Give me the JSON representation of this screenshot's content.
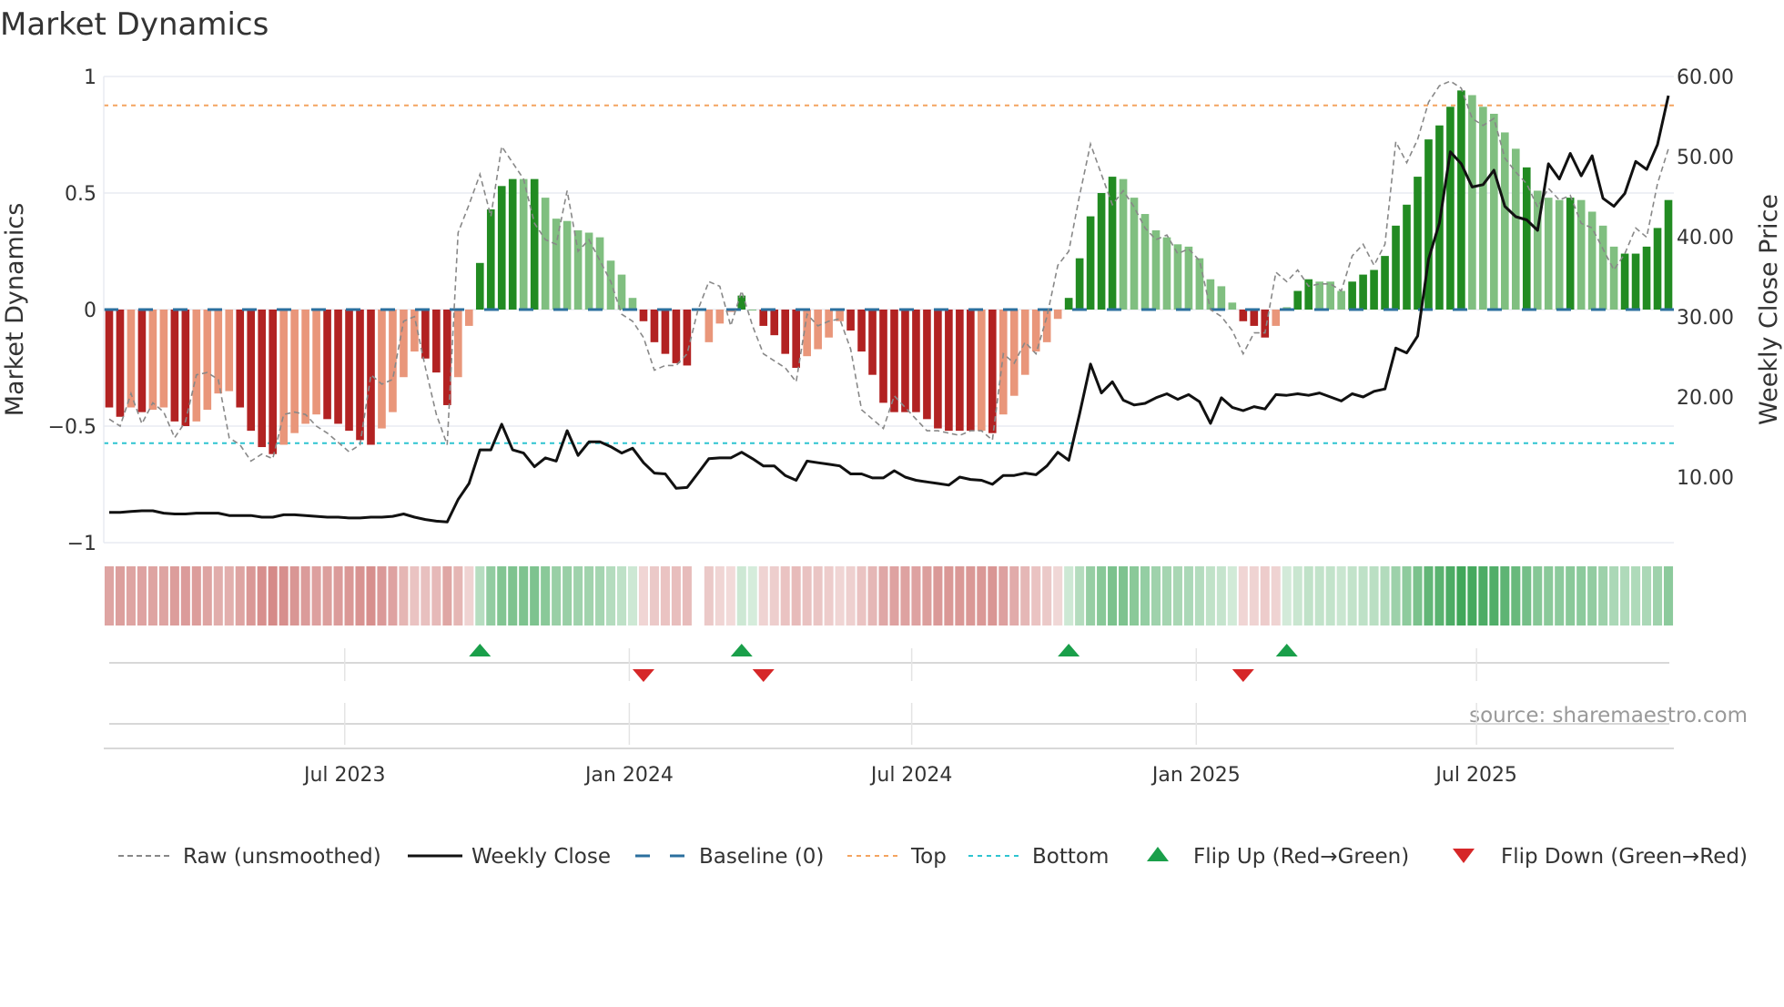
{
  "chart_data": {
    "type": "bar",
    "title": "Market Dynamics",
    "ylabel": "Market Dynamics",
    "y2label": "Weekly Close Price",
    "ylim": [
      -1,
      1
    ],
    "y2lim": [
      0,
      60
    ],
    "yticks": [
      "1",
      "0.5",
      "0",
      "−0.5",
      "−1"
    ],
    "ytick_values": [
      1,
      0.5,
      0,
      -0.5,
      -1
    ],
    "y2ticks": [
      "60.00",
      "50.00",
      "40.00",
      "30.00",
      "20.00",
      "10.00"
    ],
    "y2tick_values": [
      60,
      50,
      40,
      30,
      20,
      10
    ],
    "x_ticks": [
      {
        "label": "Jul 2023",
        "week": 22.6
      },
      {
        "label": "Jan 2024",
        "week": 48.7
      },
      {
        "label": "Jul 2024",
        "week": 74.6
      },
      {
        "label": "Jan 2025",
        "week": 100.7
      },
      {
        "label": "Jul 2025",
        "week": 126.4
      }
    ],
    "top_level": 0.876,
    "bottom_level": -0.573,
    "baseline": 0,
    "smoothed": [
      -0.42,
      -0.46,
      -0.42,
      -0.44,
      -0.43,
      -0.42,
      -0.48,
      -0.5,
      -0.48,
      -0.43,
      -0.36,
      -0.35,
      -0.42,
      -0.52,
      -0.59,
      -0.62,
      -0.58,
      -0.53,
      -0.49,
      -0.45,
      -0.47,
      -0.49,
      -0.52,
      -0.56,
      -0.58,
      -0.51,
      -0.44,
      -0.29,
      -0.18,
      -0.21,
      -0.27,
      -0.41,
      -0.29,
      -0.07,
      0.2,
      0.43,
      0.53,
      0.56,
      0.56,
      0.56,
      0.48,
      0.39,
      0.38,
      0.34,
      0.33,
      0.31,
      0.21,
      0.15,
      0.05,
      -0.05,
      -0.14,
      -0.19,
      -0.23,
      -0.24,
      null,
      -0.14,
      -0.06,
      -0.01,
      0.06,
      0,
      -0.07,
      -0.11,
      -0.19,
      -0.25,
      -0.2,
      -0.17,
      -0.12,
      -0.05,
      -0.09,
      -0.18,
      -0.28,
      -0.4,
      -0.44,
      -0.44,
      -0.44,
      -0.47,
      -0.51,
      -0.52,
      -0.52,
      -0.52,
      -0.52,
      -0.53,
      -0.45,
      -0.37,
      -0.28,
      -0.18,
      -0.14,
      -0.04,
      0.05,
      0.22,
      0.4,
      0.5,
      0.57,
      0.56,
      0.48,
      0.41,
      0.34,
      0.31,
      0.28,
      0.27,
      0.22,
      0.13,
      0.1,
      0.03,
      -0.05,
      -0.07,
      -0.12,
      -0.07,
      0.01,
      0.08,
      0.13,
      0.12,
      0.12,
      0.08,
      0.12,
      0.15,
      0.17,
      0.23,
      0.36,
      0.45,
      0.57,
      0.73,
      0.79,
      0.87,
      0.94,
      0.92,
      0.87,
      0.84,
      0.76,
      0.69,
      0.61,
      0.51,
      0.48,
      0.47,
      0.48,
      0.47,
      0.42,
      0.36,
      0.27,
      0.24,
      0.24,
      0.27,
      0.35,
      0.47
    ],
    "strong": [
      1,
      1,
      0,
      1,
      0,
      0,
      1,
      1,
      0,
      0,
      0,
      0,
      1,
      1,
      1,
      1,
      0,
      0,
      0,
      0,
      1,
      1,
      1,
      1,
      1,
      0,
      0,
      0,
      0,
      1,
      1,
      1,
      0,
      0,
      1,
      1,
      1,
      1,
      0,
      1,
      0,
      0,
      0,
      0,
      0,
      0,
      0,
      0,
      0,
      1,
      1,
      1,
      1,
      1,
      0,
      0,
      0,
      0,
      1,
      0,
      1,
      1,
      1,
      1,
      0,
      0,
      0,
      0,
      1,
      1,
      1,
      1,
      1,
      1,
      1,
      1,
      1,
      1,
      1,
      1,
      0,
      1,
      0,
      0,
      0,
      0,
      0,
      0,
      1,
      1,
      1,
      1,
      1,
      0,
      0,
      0,
      0,
      0,
      0,
      0,
      0,
      0,
      0,
      0,
      1,
      1,
      1,
      0,
      0,
      1,
      1,
      0,
      0,
      0,
      1,
      1,
      1,
      1,
      1,
      1,
      1,
      1,
      1,
      1,
      1,
      0,
      0,
      0,
      0,
      0,
      1,
      0,
      0,
      0,
      1,
      0,
      0,
      0,
      0,
      1,
      1,
      1,
      1,
      1
    ],
    "raw": [
      -0.47,
      -0.5,
      -0.36,
      -0.49,
      -0.4,
      -0.44,
      -0.55,
      -0.48,
      -0.28,
      -0.27,
      -0.3,
      -0.55,
      -0.58,
      -0.65,
      -0.62,
      -0.64,
      -0.45,
      -0.44,
      -0.45,
      -0.5,
      -0.53,
      -0.57,
      -0.61,
      -0.58,
      -0.28,
      -0.32,
      -0.3,
      -0.05,
      -0.03,
      -0.25,
      -0.45,
      -0.58,
      0.33,
      0.45,
      0.58,
      0.4,
      0.7,
      0.63,
      0.56,
      0.37,
      0.3,
      0.28,
      0.51,
      0.25,
      0.3,
      0.21,
      0.12,
      -0.02,
      -0.05,
      -0.12,
      -0.26,
      -0.24,
      -0.24,
      -0.19,
      0.0,
      0.12,
      0.1,
      -0.07,
      0.08,
      -0.07,
      -0.19,
      -0.22,
      -0.25,
      -0.31,
      -0.02,
      -0.07,
      -0.05,
      -0.04,
      -0.17,
      -0.43,
      -0.47,
      -0.51,
      -0.37,
      -0.42,
      -0.47,
      -0.52,
      -0.52,
      -0.53,
      -0.54,
      -0.52,
      -0.52,
      -0.56,
      -0.19,
      -0.23,
      -0.14,
      -0.19,
      -0.03,
      0.19,
      0.25,
      0.49,
      0.71,
      0.58,
      0.45,
      0.51,
      0.44,
      0.35,
      0.3,
      0.32,
      0.24,
      0.26,
      0.21,
      0.0,
      -0.03,
      -0.09,
      -0.19,
      -0.1,
      -0.1,
      0.16,
      0.12,
      0.17,
      0.1,
      0.11,
      0.11,
      0.08,
      0.23,
      0.28,
      0.19,
      0.28,
      0.72,
      0.63,
      0.73,
      0.89,
      0.96,
      0.98,
      0.95,
      0.82,
      0.79,
      0.82,
      0.65,
      0.59,
      0.54,
      0.44,
      0.52,
      0.47,
      0.49,
      0.37,
      0.35,
      0.26,
      0.17,
      0.24,
      0.35,
      0.31,
      0.54,
      0.69
    ],
    "weekly_close": [
      5.6,
      5.6,
      5.7,
      5.8,
      5.8,
      5.5,
      5.4,
      5.4,
      5.5,
      5.5,
      5.5,
      5.2,
      5.2,
      5.2,
      5.0,
      5.0,
      5.3,
      5.3,
      5.2,
      5.1,
      5.0,
      5.0,
      4.9,
      4.9,
      5.0,
      5.0,
      5.1,
      5.4,
      5.0,
      4.7,
      4.5,
      4.4,
      7.2,
      9.2,
      13.4,
      13.4,
      16.6,
      13.4,
      13.0,
      11.3,
      12.4,
      12.0,
      15.8,
      12.7,
      14.4,
      14.4,
      13.8,
      13.0,
      13.6,
      11.8,
      10.5,
      10.4,
      8.6,
      8.7,
      10.5,
      12.3,
      12.4,
      12.4,
      13.1,
      12.3,
      11.4,
      11.4,
      10.2,
      9.6,
      12.0,
      11.8,
      11.6,
      11.4,
      10.4,
      10.4,
      9.9,
      9.9,
      10.8,
      10.0,
      9.6,
      9.4,
      9.2,
      9.0,
      10.0,
      9.7,
      9.6,
      9.1,
      10.2,
      10.2,
      10.5,
      10.3,
      11.4,
      13.1,
      12.1,
      17.9,
      24.1,
      20.5,
      21.9,
      19.6,
      19.0,
      19.2,
      19.9,
      20.4,
      19.7,
      20.3,
      19.4,
      16.7,
      19.9,
      18.7,
      18.3,
      18.8,
      18.5,
      20.3,
      20.2,
      20.4,
      20.2,
      20.5,
      20.0,
      19.5,
      20.4,
      20.0,
      20.7,
      21.0,
      26.1,
      25.5,
      27.6,
      37.2,
      41.7,
      50.6,
      49.1,
      46.2,
      46.5,
      48.3,
      43.8,
      42.5,
      42.1,
      40.8,
      49.1,
      47.2,
      50.4,
      47.6,
      50.1,
      44.8,
      43.8,
      45.4,
      49.4,
      48.4,
      51.5,
      57.6
    ],
    "flip_up_weeks": [
      35,
      59,
      89,
      109
    ],
    "flip_down_weeks": [
      50,
      61,
      105
    ],
    "legend": {
      "placement": "bottom",
      "items": [
        "Raw (unsmoothed)",
        "Weekly Close",
        "Baseline (0)",
        "Top",
        "Bottom",
        "Flip Up (Red→Green)",
        "Flip Down (Green→Red)"
      ]
    },
    "colors": {
      "strong_red": "#b22222",
      "weak_red": "#e9967a",
      "strong_green": "#228b22",
      "weak_green": "#80bf80",
      "close": "#111111",
      "raw": "#888888",
      "baseline": "#2b6f9e",
      "top": "#f4a460",
      "bottom": "#2ec4d0",
      "flip_up": "#1a9f4a",
      "flip_down": "#d62728"
    }
  },
  "source": "source: sharemaestro.com"
}
